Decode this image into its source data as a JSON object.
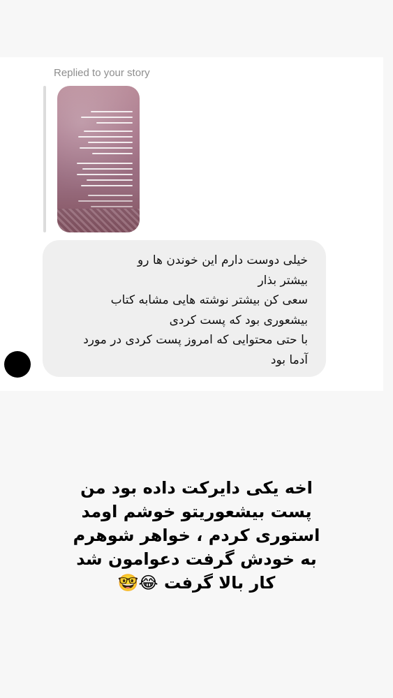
{
  "reply_context": {
    "label": "Replied to your story"
  },
  "message": {
    "lines": [
      "خیلی دوست دارم این خوندن ها رو",
      "بیشتر بذار",
      "سعی کن بیشتر نوشته هایی مشابه کتاب",
      "بیشعوری بود که پست کردی",
      "با حتی محتوایی که امروز پست کردی در مورد",
      "آدما بود"
    ]
  },
  "caption": {
    "lines": [
      "اخه یکی دایرکت داده بود من",
      "پست بیشعوریتو خوشم اومد",
      "استوری کردم ، خواهر شوهرم",
      "به خودش گرفت دعوامون شد",
      "کار بالا گرفت 😂🤓"
    ]
  },
  "colors": {
    "background": "#f7f7f7",
    "card": "#ffffff",
    "bubble": "#efefef",
    "meta_text": "#8e8e8e",
    "avatar": "#000000"
  },
  "icons": {
    "avatar": "avatar-circle",
    "story_thumbnail": "story-image"
  }
}
